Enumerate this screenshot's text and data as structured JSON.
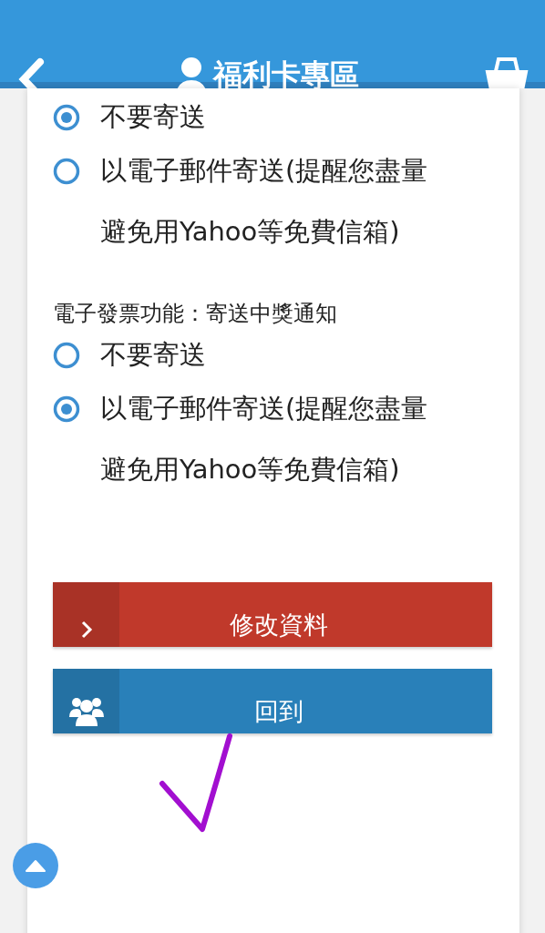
{
  "header": {
    "title": "福利卡專區"
  },
  "groups": [
    {
      "options": [
        {
          "label": "不要寄送",
          "selected": true
        },
        {
          "label": "以電子郵件寄送(提醒您盡量避免用Yahoo等免費信箱)",
          "selected": false
        }
      ]
    },
    {
      "label": "電子發票功能：寄送中獎通知",
      "options": [
        {
          "label": "不要寄送",
          "selected": false
        },
        {
          "label": "以電子郵件寄送(提醒您盡量避免用Yahoo等免費信箱)",
          "selected": true
        }
      ]
    }
  ],
  "buttons": [
    {
      "label": "修改資料",
      "kind": "edit"
    },
    {
      "label": "回到",
      "kind": "members"
    }
  ]
}
